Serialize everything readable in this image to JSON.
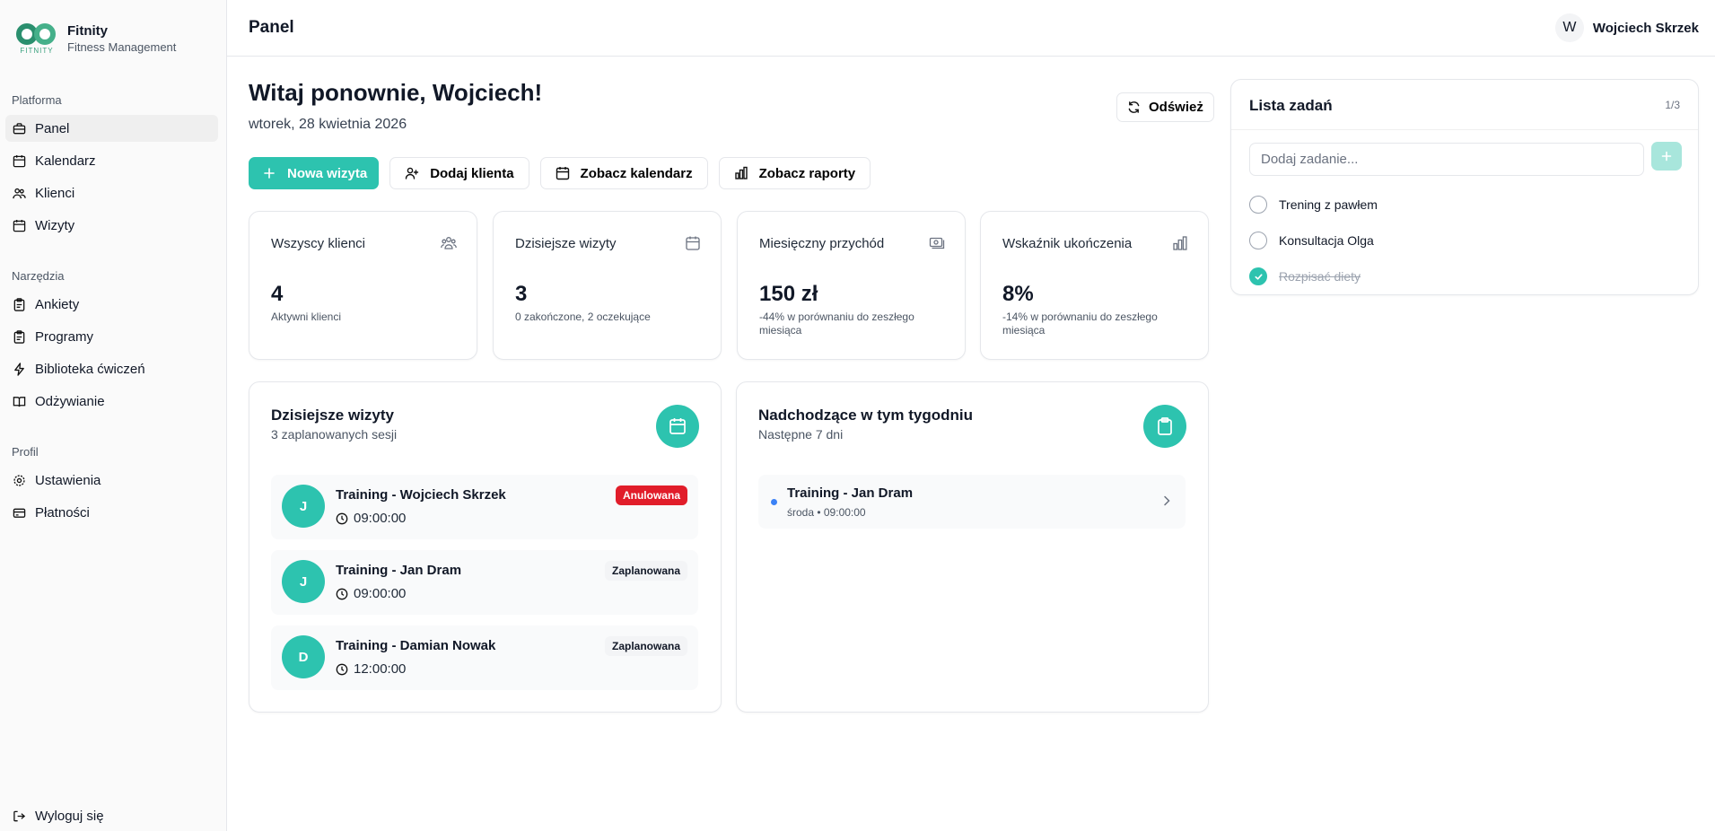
{
  "brand": {
    "name": "Fitnity",
    "subtitle": "Fitness Management",
    "logo_word": "FITNITY"
  },
  "sidebar": {
    "sections": [
      {
        "label": "Platforma",
        "items": [
          {
            "label": "Panel",
            "icon": "briefcase-icon",
            "active": true
          },
          {
            "label": "Kalendarz",
            "icon": "calendar-icon"
          },
          {
            "label": "Klienci",
            "icon": "users-icon"
          },
          {
            "label": "Wizyty",
            "icon": "calendar-icon"
          }
        ]
      },
      {
        "label": "Narzędzia",
        "items": [
          {
            "label": "Ankiety",
            "icon": "clipboard-icon"
          },
          {
            "label": "Programy",
            "icon": "clipboard-icon"
          },
          {
            "label": "Biblioteka ćwiczeń",
            "icon": "lightning-icon"
          },
          {
            "label": "Odżywianie",
            "icon": "book-icon"
          }
        ]
      },
      {
        "label": "Profil",
        "items": [
          {
            "label": "Ustawienia",
            "icon": "gear-icon"
          },
          {
            "label": "Płatności",
            "icon": "credit-card-icon"
          }
        ]
      }
    ],
    "logout_label": "Wyloguj się"
  },
  "header": {
    "title": "Panel",
    "user_initial": "W",
    "user_name": "Wojciech Skrzek"
  },
  "main": {
    "welcome": "Witaj ponownie, Wojciech!",
    "date": "wtorek, 28 kwietnia 2026",
    "refresh_label": "Odśwież",
    "actions": {
      "new_visit": "Nowa wizyta",
      "add_client": "Dodaj klienta",
      "view_calendar": "Zobacz kalendarz",
      "view_reports": "Zobacz raporty"
    },
    "stats": [
      {
        "label": "Wszyscy klienci",
        "value": "4",
        "sub": "Aktywni klienci",
        "icon": "users-icon"
      },
      {
        "label": "Dzisiejsze wizyty",
        "value": "3",
        "sub": "0 zakończone, 2 oczekujące",
        "icon": "calendar-icon"
      },
      {
        "label": "Miesięczny przychód",
        "value": "150 zł",
        "sub": "-44% w porównaniu do zeszłego miesiąca",
        "icon": "money-icon"
      },
      {
        "label": "Wskaźnik ukończenia",
        "value": "8%",
        "sub": "-14% w porównaniu do zeszłego miesiąca",
        "icon": "bar-chart-icon"
      }
    ],
    "today_visits": {
      "title": "Dzisiejsze wizyty",
      "subtitle": "3 zaplanowanych sesji",
      "items": [
        {
          "initial": "J",
          "name": "Training - Wojciech Skrzek",
          "time": "09:00:00",
          "status": "Anulowana",
          "status_type": "cancelled"
        },
        {
          "initial": "J",
          "name": "Training - Jan Dram",
          "time": "09:00:00",
          "status": "Zaplanowana",
          "status_type": "scheduled"
        },
        {
          "initial": "D",
          "name": "Training - Damian Nowak",
          "time": "12:00:00",
          "status": "Zaplanowana",
          "status_type": "scheduled"
        }
      ]
    },
    "upcoming": {
      "title": "Nadchodzące w tym tygodniu",
      "subtitle": "Następne 7 dni",
      "items": [
        {
          "name": "Training - Jan Dram",
          "meta": "środa • 09:00:00"
        }
      ]
    }
  },
  "tasks": {
    "title": "Lista zadań",
    "count": "1/3",
    "input_placeholder": "Dodaj zadanie...",
    "input_value": "",
    "items": [
      {
        "label": "Trening z pawłem",
        "done": false
      },
      {
        "label": "Konsultacja Olga",
        "done": false
      },
      {
        "label": "Rozpisać diety",
        "done": true
      }
    ]
  },
  "colors": {
    "accent": "#2dc3af",
    "danger": "#e11d2a",
    "upcoming_dot": "#3b82f6",
    "logo": "#2b9c78"
  }
}
